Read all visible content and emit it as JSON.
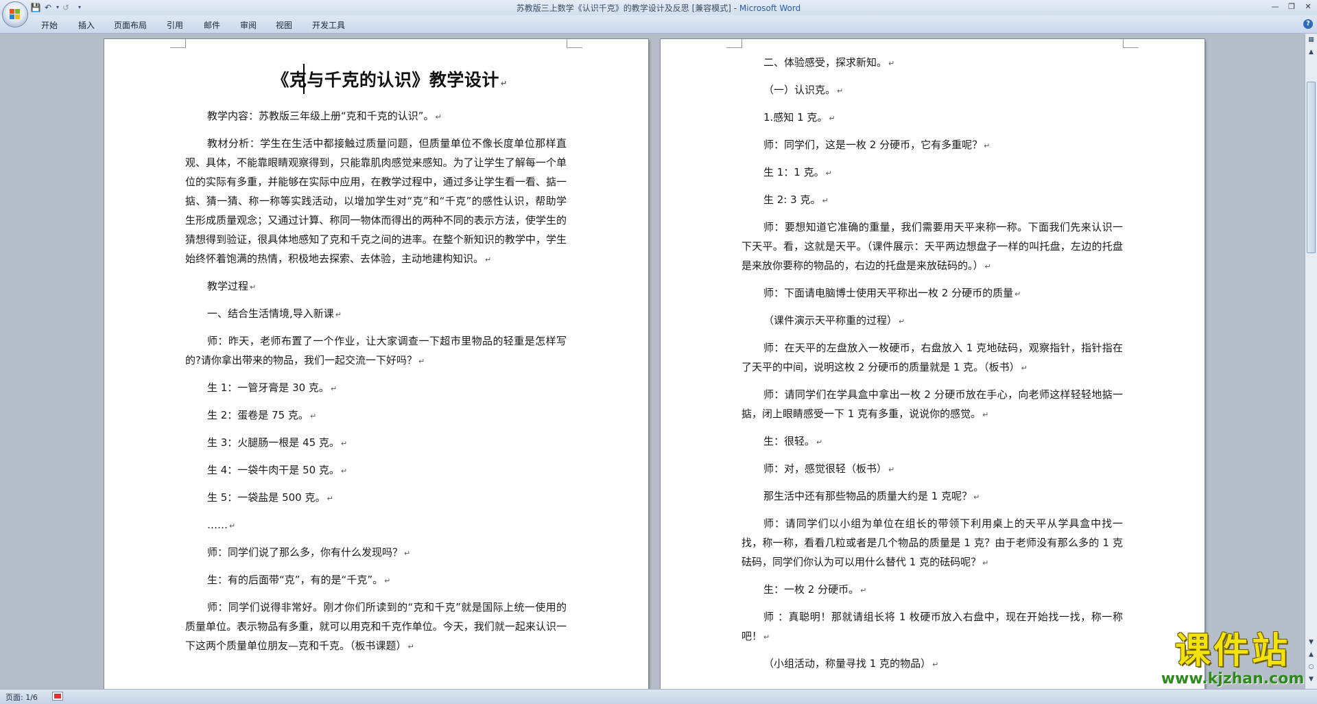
{
  "titlebar": {
    "doc_title": "苏教版三上数学《认识千克》的教学设计及反思 [兼容模式] - ",
    "app_name": "Microsoft Word"
  },
  "ribbon": {
    "tabs": [
      "开始",
      "插入",
      "页面布局",
      "引用",
      "邮件",
      "审阅",
      "视图",
      "开发工具"
    ]
  },
  "page1": {
    "title": "《克与千克的认识》教学设计",
    "paragraphs": [
      "教学内容：苏教版三年级上册“克和千克的认识”。",
      "教材分析：学生在生活中都接触过质量问题，但质量单位不像长度单位那样直观、具体，不能靠眼睛观察得到，只能靠肌肉感觉来感知。为了让学生了解每一个单位的实际有多重，并能够在实际中应用，在教学过程中，通过多让学生看一看、掂一掂、猜一猜、称一称等实践活动，以增加学生对“克”和“千克”的感性认识，帮助学生形成质量观念；又通过计算、称同一物体而得出的两种不同的表示方法，使学生的猜想得到验证，很具体地感知了克和千克之间的进率。在整个新知识的教学中，学生始终怀着饱满的热情，积极地去探索、去体验，主动地建构知识。",
      "教学过程",
      "一、结合生活情境,导入新课",
      "师：昨天，老师布置了一个作业，让大家调查一下超市里物品的轻重是怎样写的?请你拿出带来的物品，我们一起交流一下好吗？",
      "生 1：一管牙膏是 30 克。",
      "生 2：蛋卷是 75 克。",
      "生 3：火腿肠一根是 45 克。",
      "生 4：一袋牛肉干是 50 克。",
      "生 5：一袋盐是 500 克。",
      "……",
      "师：同学们说了那么多，你有什么发现吗？",
      "生：有的后面带“克”，有的是“千克”。",
      "师：同学们说得非常好。刚才你们所读到的“克和千克”就是国际上统一使用的质量单位。表示物品有多重，就可以用克和千克作单位。今天，我们就一起来认识一下这两个质量单位朋友—克和千克。（板书课题）"
    ]
  },
  "page2": {
    "paragraphs": [
      "二、体验感受，探求新知。",
      "（一）认识克。",
      "1.感知 1 克。",
      "师：同学们，这是一枚 2 分硬币，它有多重呢？",
      "生 1：1 克。",
      "生 2: 3 克。",
      "师：要想知道它准确的重量，我们需要用天平来称一称。下面我们先来认识一下天平。看，这就是天平。（课件展示：天平两边想盘子一样的叫托盘，左边的托盘是来放你要称的物品的，右边的托盘是来放砝码的。）",
      "师：下面请电脑博士使用天平称出一枚 2 分硬币的质量",
      "（课件演示天平称重的过程）",
      "师：在天平的左盘放入一枚硬币，右盘放入 1 克地砝码，观察指针，指针指在了天平的中间，说明这枚 2 分硬币的质量就是 1 克。（板书）",
      "师：请同学们在学具盒中拿出一枚 2 分硬币放在手心，向老师这样轻轻地掂一掂，闭上眼睛感受一下 1 克有多重，说说你的感觉。",
      "生：很轻。",
      "师：对，感觉很轻（板书）",
      "那生活中还有那些物品的质量大约是 1 克呢？",
      "师：请同学们以小组为单位在组长的带领下利用桌上的天平从学具盒中找一找，称一称，看看几粒或者是几个物品的质量是 1 克？由于老师没有那么多的 1 克砝码，同学们你认为可以用什么替代 1 克的砝码呢？",
      "生：一枚 2 分硬币。",
      "师 ：真聪明！那就请组长将 1 枚硬币放入右盘中，现在开始找一找，称一称吧！",
      "（小组活动，称量寻找 1 克的物品）"
    ]
  },
  "statusbar": {
    "page_info": "页面: 1/6"
  },
  "watermark": {
    "main": "课件站",
    "url": "www.kjzhan.com"
  },
  "colors": {
    "app_name": "#2a5ca8",
    "watermark_main": "#f3e20c",
    "watermark_url": "#2f8a1d"
  }
}
